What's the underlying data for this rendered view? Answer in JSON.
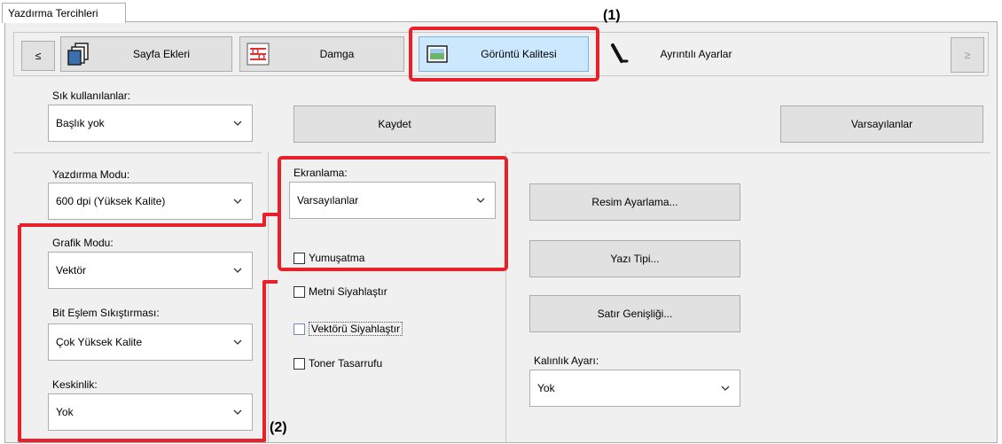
{
  "window": {
    "tab_title": "Yazdırma Tercihleri"
  },
  "nav": {
    "prev": "≤",
    "next": "≥",
    "tabs": [
      {
        "label": "Sayfa Ekleri",
        "icon": "pages-icon"
      },
      {
        "label": "Damga",
        "icon": "stamp-icon"
      },
      {
        "label": "Görüntü Kalitesi",
        "icon": "image-quality-icon"
      },
      {
        "label": "Ayrıntılı Ayarlar",
        "icon": "detailed-settings-icon"
      }
    ]
  },
  "favorites": {
    "label": "Sık kullanılanlar:",
    "value": "Başlık yok",
    "save": "Kaydet",
    "defaults": "Varsayılanlar"
  },
  "print_mode": {
    "label": "Yazdırma Modu:",
    "value": "600 dpi (Yüksek Kalite)"
  },
  "graphic_mode": {
    "label": "Grafik Modu:",
    "value": "Vektör"
  },
  "bitmap_compression": {
    "label": "Bit Eşlem Sıkıştırması:",
    "value": "Çok Yüksek Kalite"
  },
  "sharpness": {
    "label": "Keskinlik:",
    "value": "Yok"
  },
  "screening": {
    "label": "Ekranlama:",
    "value": "Varsayılanlar",
    "smoothing": "Yumuşatma"
  },
  "checks": {
    "black_text": "Metni Siyahlaştır",
    "black_vector": "Vektörü Siyahlaştır",
    "toner_save": "Toner Tasarrufu"
  },
  "buttons": {
    "image_adjust": "Resim Ayarlama...",
    "font": "Yazı Tipi...",
    "line_width": "Satır Genişliği..."
  },
  "thickness": {
    "label": "Kalınlık Ayarı:",
    "value": "Yok"
  },
  "callouts": {
    "one": "(1)",
    "two": "(2)"
  },
  "colors": {
    "highlight": "#e8202a",
    "selected_tab": "#cce8ff"
  }
}
